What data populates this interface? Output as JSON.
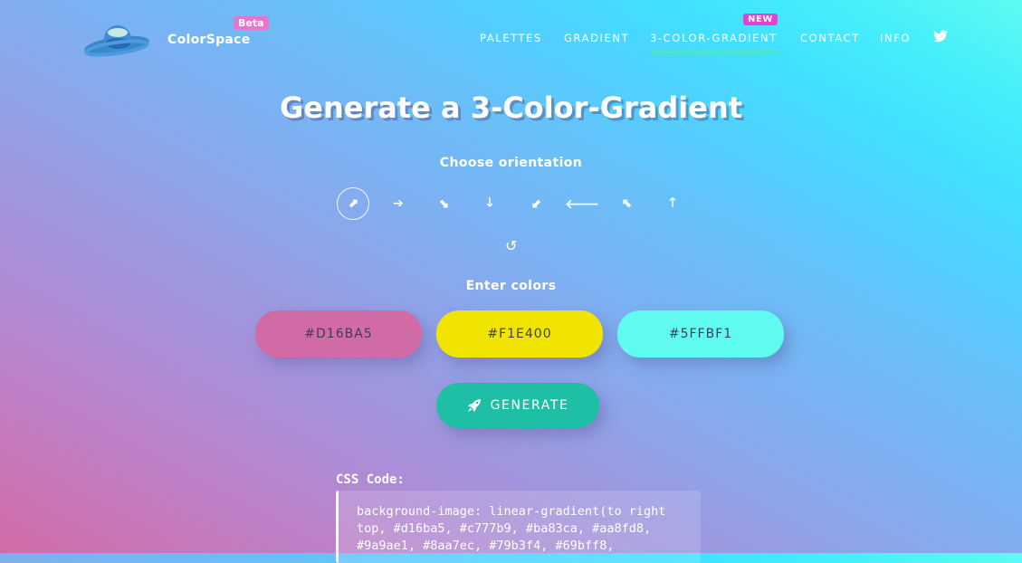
{
  "header": {
    "brand": "ColorSpace",
    "beta_badge": "Beta",
    "new_badge": "NEW",
    "nav": [
      "PALETTES",
      "GRADIENT",
      "3-COLOR-GRADIENT",
      "CONTACT",
      "INFO"
    ],
    "active_nav": "3-COLOR-GRADIENT"
  },
  "main": {
    "title": "Generate a 3-Color-Gradient",
    "orientation_label": "Choose orientation",
    "orientations": [
      "to right top",
      "to right",
      "to right bottom",
      "to bottom",
      "to left bottom",
      "to left",
      "to left top",
      "to top"
    ],
    "selected_orientation": "to right top",
    "colors_label": "Enter colors",
    "colors": [
      {
        "value": "#D16BA5",
        "bg": "#d16ba5"
      },
      {
        "value": "#F1E400",
        "bg": "#f1e400"
      },
      {
        "value": "#5FFBF1",
        "bg": "#5ffbf1"
      }
    ],
    "generate_label": "GENERATE",
    "css_label": "CSS Code:",
    "css_code": "background-image: linear-gradient(to right top, #d16ba5, #c777b9, #ba83ca, #aa8fd8, #9a9ae1, #8aa7ec, #79b3f4, #69bff8,"
  },
  "icons": {
    "logo": "planet-saturn-icon",
    "twitter": "twitter-icon",
    "reset": "reset-icon",
    "generate": "rocket-icon"
  },
  "theme": {
    "accent": "#1ebfa4",
    "active_underline": "#4fe6c5",
    "new_badge": "#e93fd0",
    "beta_badge": "#e676c9"
  }
}
